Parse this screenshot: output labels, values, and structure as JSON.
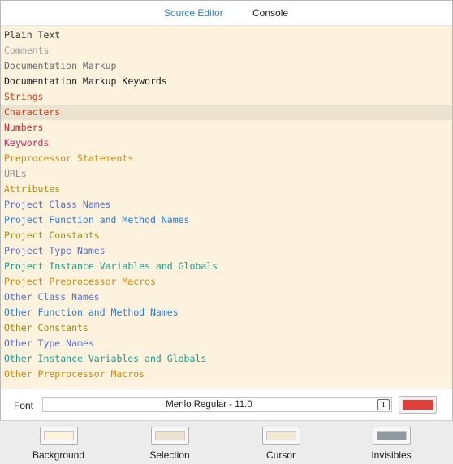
{
  "tabs": [
    {
      "label": "Source Editor",
      "active": true
    },
    {
      "label": "Console",
      "active": false
    }
  ],
  "syntax_items": [
    {
      "label": "Plain Text",
      "color": "#333333"
    },
    {
      "label": "Comments",
      "color": "#9d9d9d"
    },
    {
      "label": "Documentation Markup",
      "color": "#6b6b6b"
    },
    {
      "label": "Documentation Markup Keywords",
      "color": "#1a1a1a"
    },
    {
      "label": "Strings",
      "color": "#c73d14"
    },
    {
      "label": "Characters",
      "color": "#c73d14",
      "selected": true
    },
    {
      "label": "Numbers",
      "color": "#cf2a28"
    },
    {
      "label": "Keywords",
      "color": "#cf2a63"
    },
    {
      "label": "Preprocessor Statements",
      "color": "#c88a14"
    },
    {
      "label": "URLs",
      "color": "#8c8c8c"
    },
    {
      "label": "Attributes",
      "color": "#b8860b"
    },
    {
      "label": "Project Class Names",
      "color": "#5d6fc7"
    },
    {
      "label": "Project Function and Method Names",
      "color": "#2f7bd0"
    },
    {
      "label": "Project Constants",
      "color": "#9b8b14"
    },
    {
      "label": "Project Type Names",
      "color": "#5d6fc7"
    },
    {
      "label": "Project Instance Variables and Globals",
      "color": "#1f9a8a"
    },
    {
      "label": "Project Preprocessor Macros",
      "color": "#c88a14"
    },
    {
      "label": "Other Class Names",
      "color": "#5d6fc7"
    },
    {
      "label": "Other Function and Method Names",
      "color": "#2f7bd0"
    },
    {
      "label": "Other Constants",
      "color": "#9b8b14"
    },
    {
      "label": "Other Type Names",
      "color": "#5d6fc7"
    },
    {
      "label": "Other Instance Variables and Globals",
      "color": "#1f9a8a"
    },
    {
      "label": "Other Preprocessor Macros",
      "color": "#c88a14"
    }
  ],
  "font": {
    "label": "Font",
    "value": "Menlo Regular - 11.0",
    "picker_icon": "T",
    "color": "#e0403a"
  },
  "swatches": [
    {
      "label": "Background",
      "color": "#fcf2de"
    },
    {
      "label": "Selection",
      "color": "#ebe2d0"
    },
    {
      "label": "Cursor",
      "color": "#f3ead6"
    },
    {
      "label": "Invisibles",
      "color": "#8e9aa0"
    }
  ]
}
